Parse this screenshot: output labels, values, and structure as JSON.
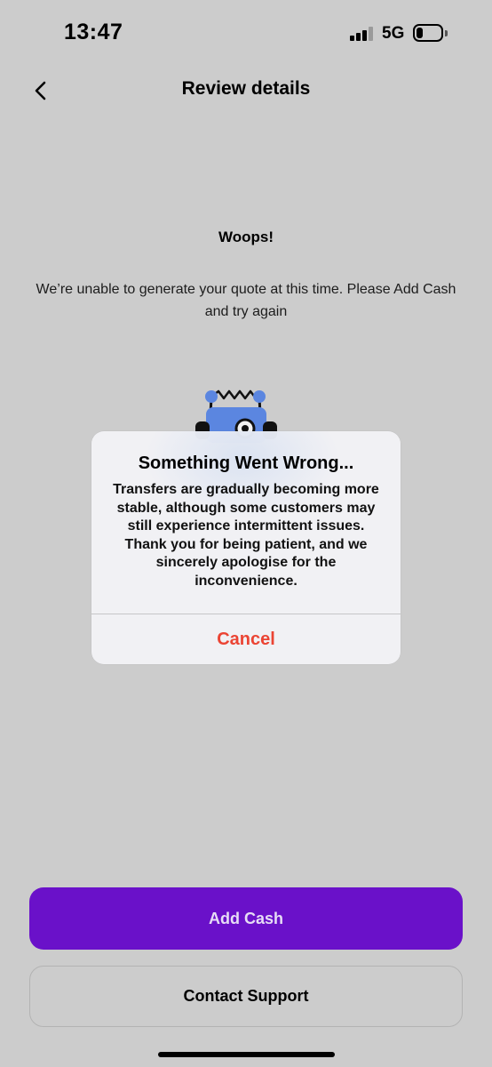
{
  "status_bar": {
    "time": "13:47",
    "network": "5G",
    "battery_level": 0.25,
    "signal_bars": 3
  },
  "nav": {
    "title": "Review details",
    "back_icon": "chevron-left-icon"
  },
  "content": {
    "heading": "Woops!",
    "message": "We’re unable to generate your quote at this time. Please Add Cash and try again",
    "illustration_icon": "robot-icon"
  },
  "alert": {
    "title": "Something Went Wrong...",
    "message": "Transfers are gradually becoming more stable, although some customers may still experience intermittent issues. Thank you for being patient, and we sincerely apologise for the inconvenience.",
    "cancel_label": "Cancel"
  },
  "actions": {
    "add_cash_label": "Add Cash",
    "contact_support_label": "Contact Support"
  },
  "colors": {
    "background": "#cccccc",
    "primary": "#6a11c9",
    "destructive": "#eb4433",
    "robot": "#5b86e0"
  }
}
